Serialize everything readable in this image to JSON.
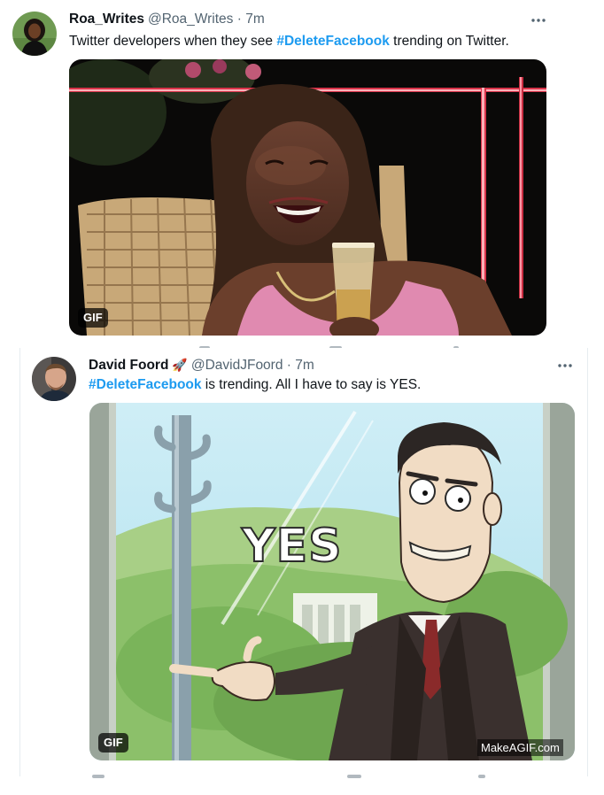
{
  "tweets": [
    {
      "name": "Roa_Writes",
      "handle": "@Roa_Writes",
      "time": "7m",
      "text_before": "Twitter developers when they see ",
      "hashtag": "#DeleteFacebook",
      "text_after": " trending on Twitter.",
      "media_badge": "GIF",
      "more_icon": "more-icon"
    },
    {
      "name": "David Foord",
      "name_emoji": "🚀",
      "handle": "@DavidJFoord",
      "time": "7m",
      "hashtag": "#DeleteFacebook",
      "text_after": " is trending.  All I have to say is YES.",
      "media_badge": "GIF",
      "media_caption": "YES",
      "watermark": "MakeAGIF.com",
      "more_icon": "more-icon"
    }
  ],
  "separator": " · ",
  "colors": {
    "hashtag": "#1d9bf0",
    "secondary_text": "#536471",
    "primary_text": "#0f1419"
  }
}
